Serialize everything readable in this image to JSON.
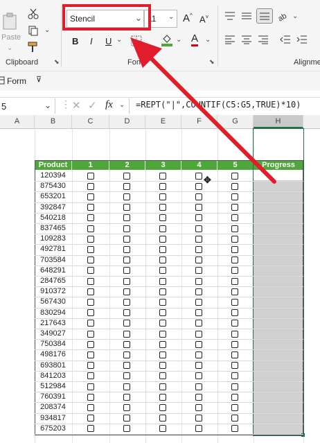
{
  "ribbon": {
    "paste_label": "Paste",
    "clipboard_label": "Clipboard",
    "font_group_label": "Font",
    "alignment_label": "Alignme",
    "font_name": "Stencil",
    "font_size": "11",
    "bold": "B",
    "italic": "I",
    "underline": "U",
    "increase_font": "A",
    "decrease_font": "A",
    "font_color_label": "A"
  },
  "toolbar2": {
    "form_label": "Form"
  },
  "formula_bar": {
    "name_box": "5",
    "fx": "fx",
    "formula": "=REPT(\"|\",COUNTIF(C5:G5,TRUE)*10)"
  },
  "columns": [
    "A",
    "B",
    "C",
    "D",
    "E",
    "F",
    "G",
    "H"
  ],
  "table": {
    "headers": [
      "Product",
      "1",
      "2",
      "3",
      "4",
      "5",
      "Progress"
    ],
    "products": [
      "120394",
      "875430",
      "653201",
      "392847",
      "540218",
      "837465",
      "109283",
      "492781",
      "703584",
      "648291",
      "284765",
      "910372",
      "567430",
      "830294",
      "217643",
      "349027",
      "750384",
      "498176",
      "693801",
      "841203",
      "512984",
      "760391",
      "208374",
      "934817",
      "675203"
    ]
  },
  "colors": {
    "header_green": "#4fa63a",
    "highlight_red": "#e11d2b",
    "progress_fill": "#d0d0d0"
  }
}
